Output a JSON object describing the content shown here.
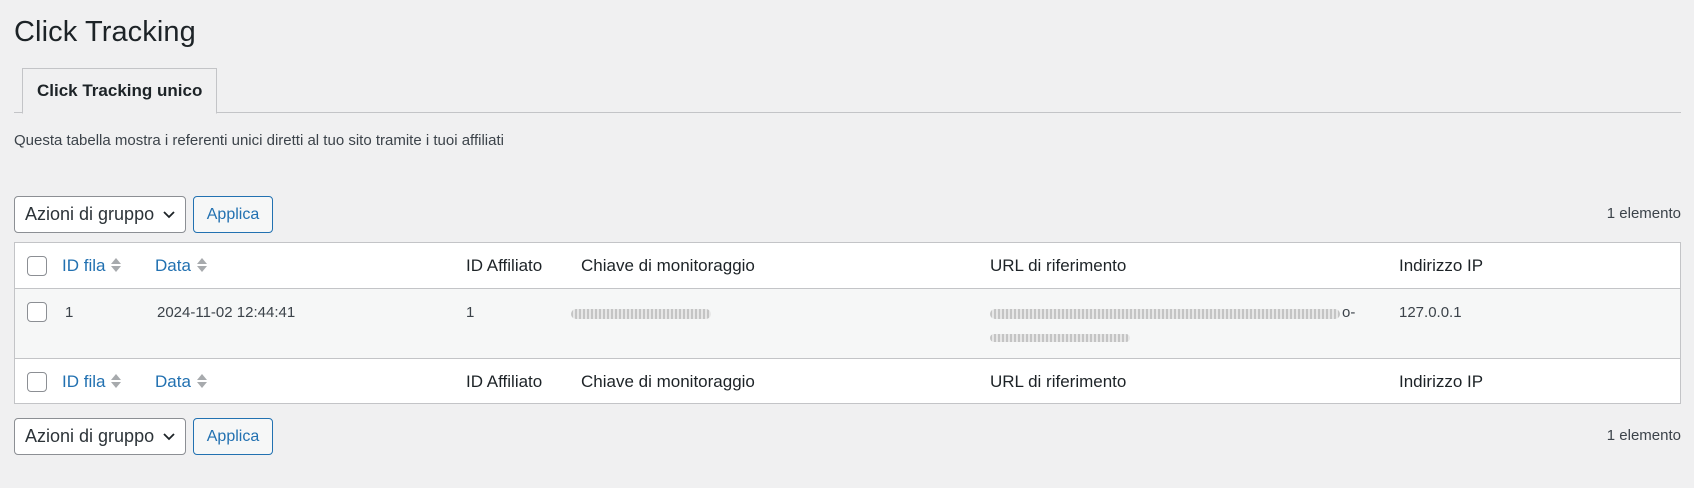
{
  "page": {
    "title": "Click Tracking"
  },
  "tabs": [
    {
      "label": "Click Tracking unico",
      "active": true
    }
  ],
  "description": "Questa tabella mostra i referenti unici diretti al tuo sito tramite i tuoi affiliati",
  "tablenav": {
    "bulk_actions": "Azioni di gruppo",
    "apply_label": "Applica",
    "item_count": "1 elemento"
  },
  "table": {
    "columns": [
      {
        "label": "ID fila",
        "sortable": true
      },
      {
        "label": "Data",
        "sortable": true
      },
      {
        "label": "ID Affiliato",
        "sortable": false
      },
      {
        "label": "Chiave di monitoraggio",
        "sortable": false
      },
      {
        "label": "URL di riferimento",
        "sortable": false
      },
      {
        "label": "Indirizzo IP",
        "sortable": false
      }
    ],
    "rows": [
      {
        "id": "1",
        "date": "2024-11-02 12:44:41",
        "affiliate_id": "1",
        "tracking_key": "",
        "referrer_url_suffix": "o-",
        "ip": "127.0.0.1"
      }
    ]
  },
  "colors": {
    "link": "#2271b1",
    "background": "#f0f0f1",
    "border": "#c3c4c7"
  },
  "icons": {
    "select_arrow": "chevron-down-icon",
    "sort": "sort-icon"
  }
}
